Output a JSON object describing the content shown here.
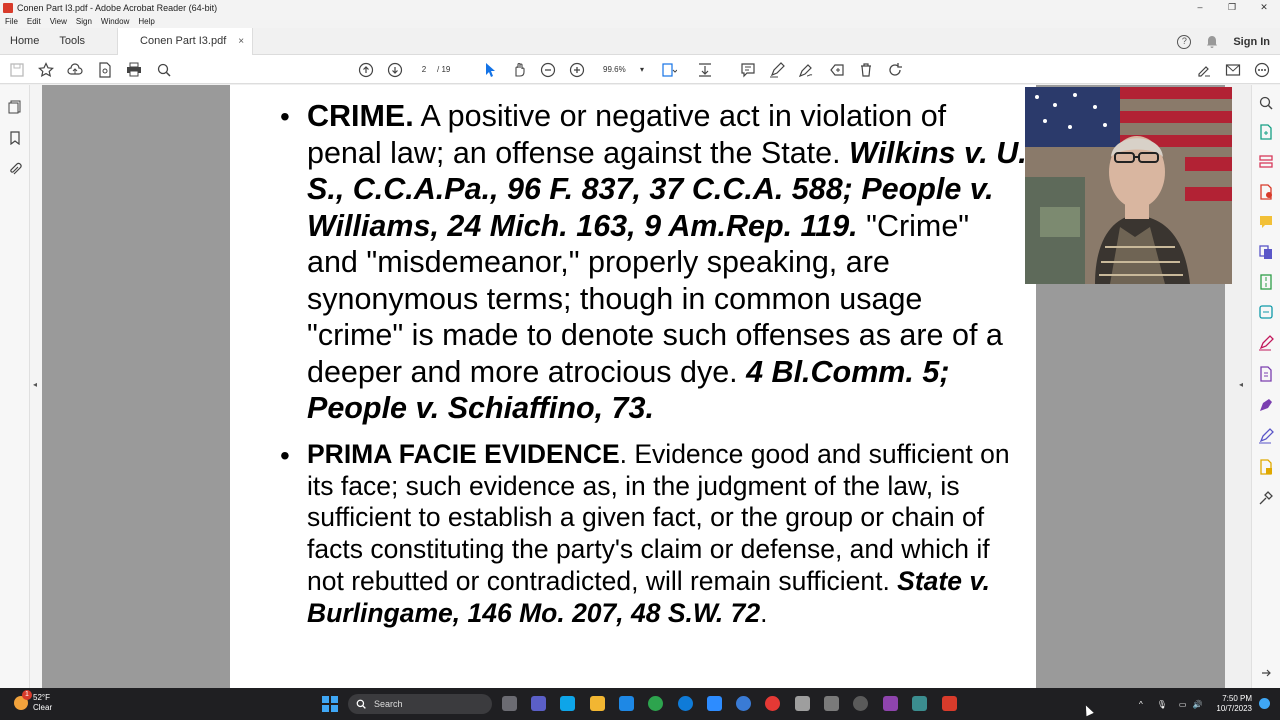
{
  "window": {
    "title": "Conen Part I3.pdf - Adobe Acrobat Reader (64-bit)",
    "controls": [
      "–",
      "❐",
      "✕"
    ]
  },
  "menu": [
    "File",
    "Edit",
    "View",
    "Sign",
    "Window",
    "Help"
  ],
  "tabs": {
    "home": "Home",
    "tools": "Tools",
    "document": "Conen Part I3.pdf",
    "close": "×",
    "sign_in": "Sign In"
  },
  "toolbar": {
    "current_page": "2",
    "total_pages": "/ 19",
    "zoom": "99.6%",
    "zoom_caret": "▾"
  },
  "page": {
    "bullet": "•",
    "entry1": {
      "term": "CRIME.",
      "text1": " A positive or negative act in violation of penal law; an offense against the State. ",
      "cite1": "Wilkins v. U. S., C.C.A.Pa., 96 F. 837, 37 C.C.A. 588; People v. Williams, 24 Mich. 163, 9 Am.Rep. 119.",
      "text2": " \"Crime\" and \"misdemeanor,\" properly speaking, are synonymous terms; though in common usage \"crime\" is made to denote such offenses as are of a deeper and more atrocious dye. ",
      "cite2": "4 Bl.Comm. 5; People v. Schiaffino, 73."
    },
    "entry2": {
      "term": "PRIMA FACIE EVIDENCE",
      "text1": ". Evidence good and sufficient on its face; such evidence as, in the judgment of the law, is sufficient to establish a given fact, or the group or chain of facts constituting the party's claim or defense, and which if not rebutted or contradicted, will remain sufficient. ",
      "cite1": "State v. Burlingame, 146 Mo. 207, 48 S.W. 72",
      "text2": "."
    }
  },
  "taskbar": {
    "weather_temp": "52°F",
    "weather_desc": "Clear",
    "weather_badge": "1",
    "search_placeholder": "Search",
    "time": "7:50 PM",
    "date": "10/7/2023",
    "tray_chevron": "^"
  },
  "colors": {
    "accent": "#1473e6",
    "acrobat_red": "#d83b2b",
    "viewer_bg": "#9a9a9a",
    "taskbar_bg": "#1f1f22"
  }
}
